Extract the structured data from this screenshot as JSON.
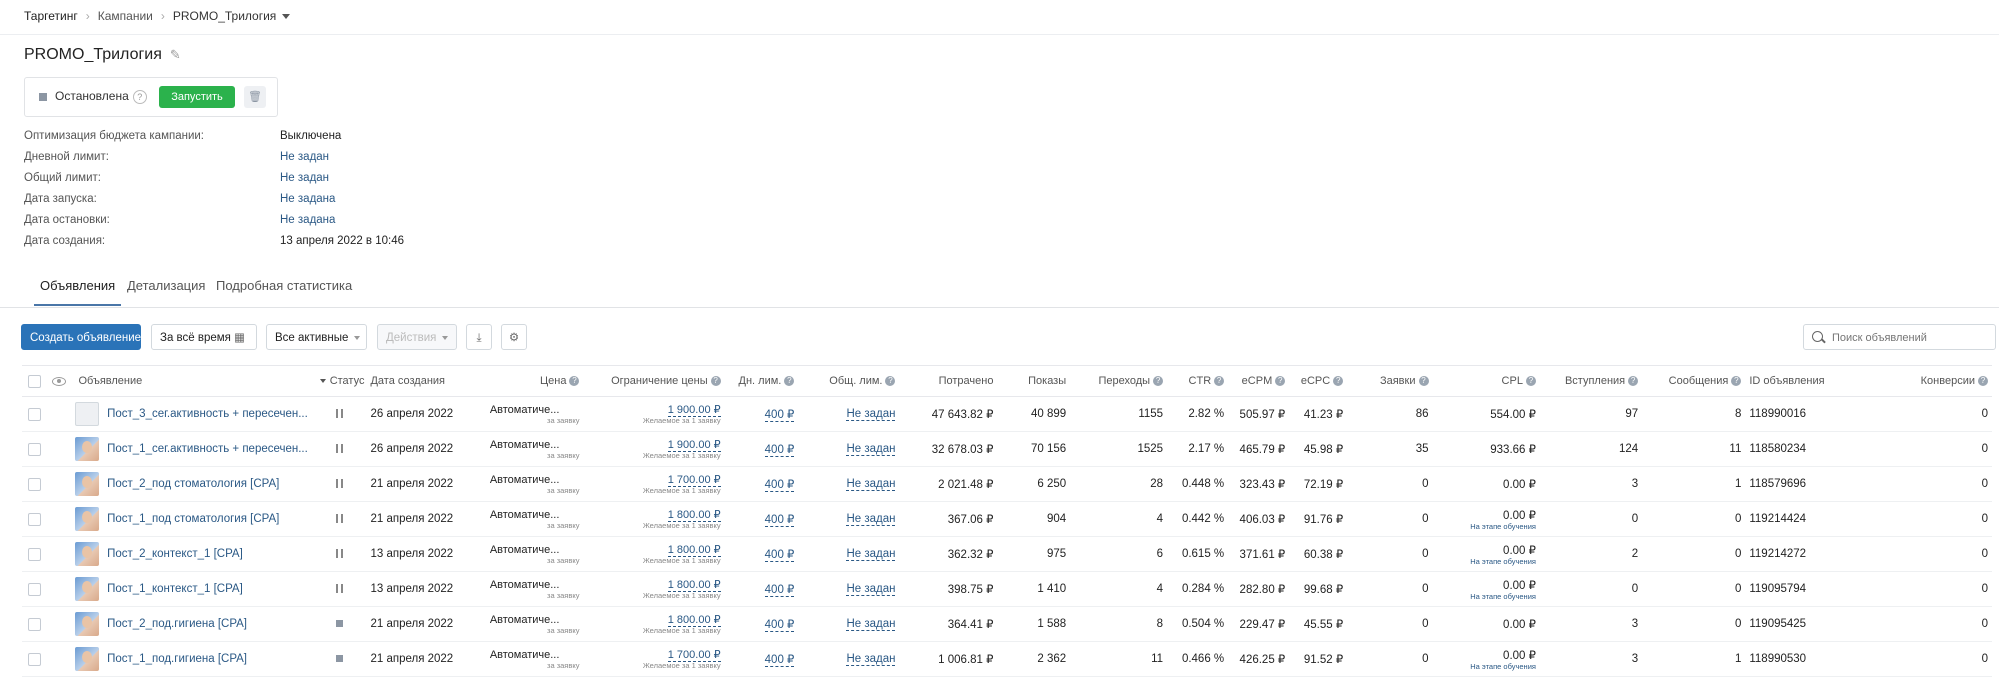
{
  "breadcrumbs": [
    "Таргетинг",
    "Кампании",
    "PROMO_Трилогия"
  ],
  "campaign": {
    "title": "PROMO_Трилогия",
    "status": "Остановлена",
    "start_button": "Запустить"
  },
  "info": [
    {
      "label": "Оптимизация бюджета кампании:",
      "value": "Выключена"
    },
    {
      "label": "Дневной лимит:",
      "value": "Не задан"
    },
    {
      "label": "Общий лимит:",
      "value": "Не задан"
    },
    {
      "label": "Дата запуска:",
      "value": "Не задана"
    },
    {
      "label": "Дата остановки:",
      "value": "Не задана"
    },
    {
      "label": "Дата создания:",
      "value": "13 апреля 2022 в 10:46"
    }
  ],
  "tabs": [
    "Объявления",
    "Детализация",
    "Подробная статистика"
  ],
  "toolbar": {
    "create": "Создать объявление",
    "period": "За всё время",
    "filter": "Все активные",
    "actions": "Действия",
    "search_placeholder": "Поиск объявлений"
  },
  "columns": [
    "Объявление",
    "Статус",
    "Дата создания",
    "Цена",
    "Ограничение цены",
    "Дн. лим.",
    "Общ. лим.",
    "Потрачено",
    "Показы",
    "Переходы",
    "CTR",
    "eCPM",
    "eCPC",
    "Заявки",
    "CPL",
    "Вступления",
    "Сообщения",
    "ID объявления",
    "Конверсии"
  ],
  "rows": [
    {
      "name": "Пост_3_сег.активность + пересечен...",
      "thumb": "blank",
      "status": "pause",
      "date": "26 апреля 2022",
      "price": "Автоматиче...",
      "price_sub": "за заявку",
      "limit": "1 900.00 ₽",
      "limit_sub": "Желаемое за 1 заявку",
      "day": "400 ₽",
      "total": "Не задан",
      "spent": "47 643.82 ₽",
      "shows": "40 899",
      "clicks": "1155",
      "ctr": "2.82 %",
      "ecpm": "505.97 ₽",
      "ecpc": "41.23 ₽",
      "leads": "86",
      "cpl": "554.00 ₽",
      "cpl_sub": "",
      "joins": "97",
      "msgs": "8",
      "id": "118990016",
      "conv": "0"
    },
    {
      "name": "Пост_1_сег.активность + пересечен...",
      "thumb": "face",
      "status": "pause",
      "date": "26 апреля 2022",
      "price": "Автоматиче...",
      "price_sub": "за заявку",
      "limit": "1 900.00 ₽",
      "limit_sub": "Желаемое за 1 заявку",
      "day": "400 ₽",
      "total": "Не задан",
      "spent": "32 678.03 ₽",
      "shows": "70 156",
      "clicks": "1525",
      "ctr": "2.17 %",
      "ecpm": "465.79 ₽",
      "ecpc": "45.98 ₽",
      "leads": "35",
      "cpl": "933.66 ₽",
      "cpl_sub": "",
      "joins": "124",
      "msgs": "11",
      "id": "118580234",
      "conv": "0"
    },
    {
      "name": "Пост_2_под стоматология [CPA]",
      "thumb": "face",
      "status": "pause",
      "date": "21 апреля 2022",
      "price": "Автоматиче...",
      "price_sub": "за заявку",
      "limit": "1 700.00 ₽",
      "limit_sub": "Желаемое за 1 заявку",
      "day": "400 ₽",
      "total": "Не задан",
      "spent": "2 021.48 ₽",
      "shows": "6 250",
      "clicks": "28",
      "ctr": "0.448 %",
      "ecpm": "323.43 ₽",
      "ecpc": "72.19 ₽",
      "leads": "0",
      "cpl": "0.00 ₽",
      "cpl_sub": "",
      "joins": "3",
      "msgs": "1",
      "id": "118579696",
      "conv": "0"
    },
    {
      "name": "Пост_1_под стоматология [CPA]",
      "thumb": "face",
      "status": "pause",
      "date": "21 апреля 2022",
      "price": "Автоматиче...",
      "price_sub": "за заявку",
      "limit": "1 800.00 ₽",
      "limit_sub": "Желаемое за 1 заявку",
      "day": "400 ₽",
      "total": "Не задан",
      "spent": "367.06 ₽",
      "shows": "904",
      "clicks": "4",
      "ctr": "0.442 %",
      "ecpm": "406.03 ₽",
      "ecpc": "91.76 ₽",
      "leads": "0",
      "cpl": "0.00 ₽",
      "cpl_sub": "На этапе обучения",
      "joins": "0",
      "msgs": "0",
      "id": "119214424",
      "conv": "0"
    },
    {
      "name": "Пост_2_контекст_1 [CPA]",
      "thumb": "face",
      "status": "pause",
      "date": "13 апреля 2022",
      "price": "Автоматиче...",
      "price_sub": "за заявку",
      "limit": "1 800.00 ₽",
      "limit_sub": "Желаемое за 1 заявку",
      "day": "400 ₽",
      "total": "Не задан",
      "spent": "362.32 ₽",
      "shows": "975",
      "clicks": "6",
      "ctr": "0.615 %",
      "ecpm": "371.61 ₽",
      "ecpc": "60.38 ₽",
      "leads": "0",
      "cpl": "0.00 ₽",
      "cpl_sub": "На этапе обучения",
      "joins": "2",
      "msgs": "0",
      "id": "119214272",
      "conv": "0"
    },
    {
      "name": "Пост_1_контекст_1 [CPA]",
      "thumb": "face",
      "status": "pause",
      "date": "13 апреля 2022",
      "price": "Автоматиче...",
      "price_sub": "за заявку",
      "limit": "1 800.00 ₽",
      "limit_sub": "Желаемое за 1 заявку",
      "day": "400 ₽",
      "total": "Не задан",
      "spent": "398.75 ₽",
      "shows": "1 410",
      "clicks": "4",
      "ctr": "0.284 %",
      "ecpm": "282.80 ₽",
      "ecpc": "99.68 ₽",
      "leads": "0",
      "cpl": "0.00 ₽",
      "cpl_sub": "На этапе обучения",
      "joins": "0",
      "msgs": "0",
      "id": "119095794",
      "conv": "0"
    },
    {
      "name": "Пост_2_под.гигиена [CPA]",
      "thumb": "face",
      "status": "stop",
      "date": "21 апреля 2022",
      "price": "Автоматиче...",
      "price_sub": "за заявку",
      "limit": "1 800.00 ₽",
      "limit_sub": "Желаемое за 1 заявку",
      "day": "400 ₽",
      "total": "Не задан",
      "spent": "364.41 ₽",
      "shows": "1 588",
      "clicks": "8",
      "ctr": "0.504 %",
      "ecpm": "229.47 ₽",
      "ecpc": "45.55 ₽",
      "leads": "0",
      "cpl": "0.00 ₽",
      "cpl_sub": "",
      "joins": "3",
      "msgs": "0",
      "id": "119095425",
      "conv": "0"
    },
    {
      "name": "Пост_1_под.гигиена [CPA]",
      "thumb": "face",
      "status": "stop",
      "date": "21 апреля 2022",
      "price": "Автоматиче...",
      "price_sub": "за заявку",
      "limit": "1 700.00 ₽",
      "limit_sub": "Желаемое за 1 заявку",
      "day": "400 ₽",
      "total": "Не задан",
      "spent": "1 006.81 ₽",
      "shows": "2 362",
      "clicks": "11",
      "ctr": "0.466 %",
      "ecpm": "426.25 ₽",
      "ecpc": "91.52 ₽",
      "leads": "0",
      "cpl": "0.00 ₽",
      "cpl_sub": "На этапе обучения",
      "joins": "3",
      "msgs": "1",
      "id": "118990530",
      "conv": "0"
    }
  ],
  "colors": {
    "accent": "#2a73b8",
    "start_green": "#2bb24c",
    "link": "#2a5885"
  }
}
